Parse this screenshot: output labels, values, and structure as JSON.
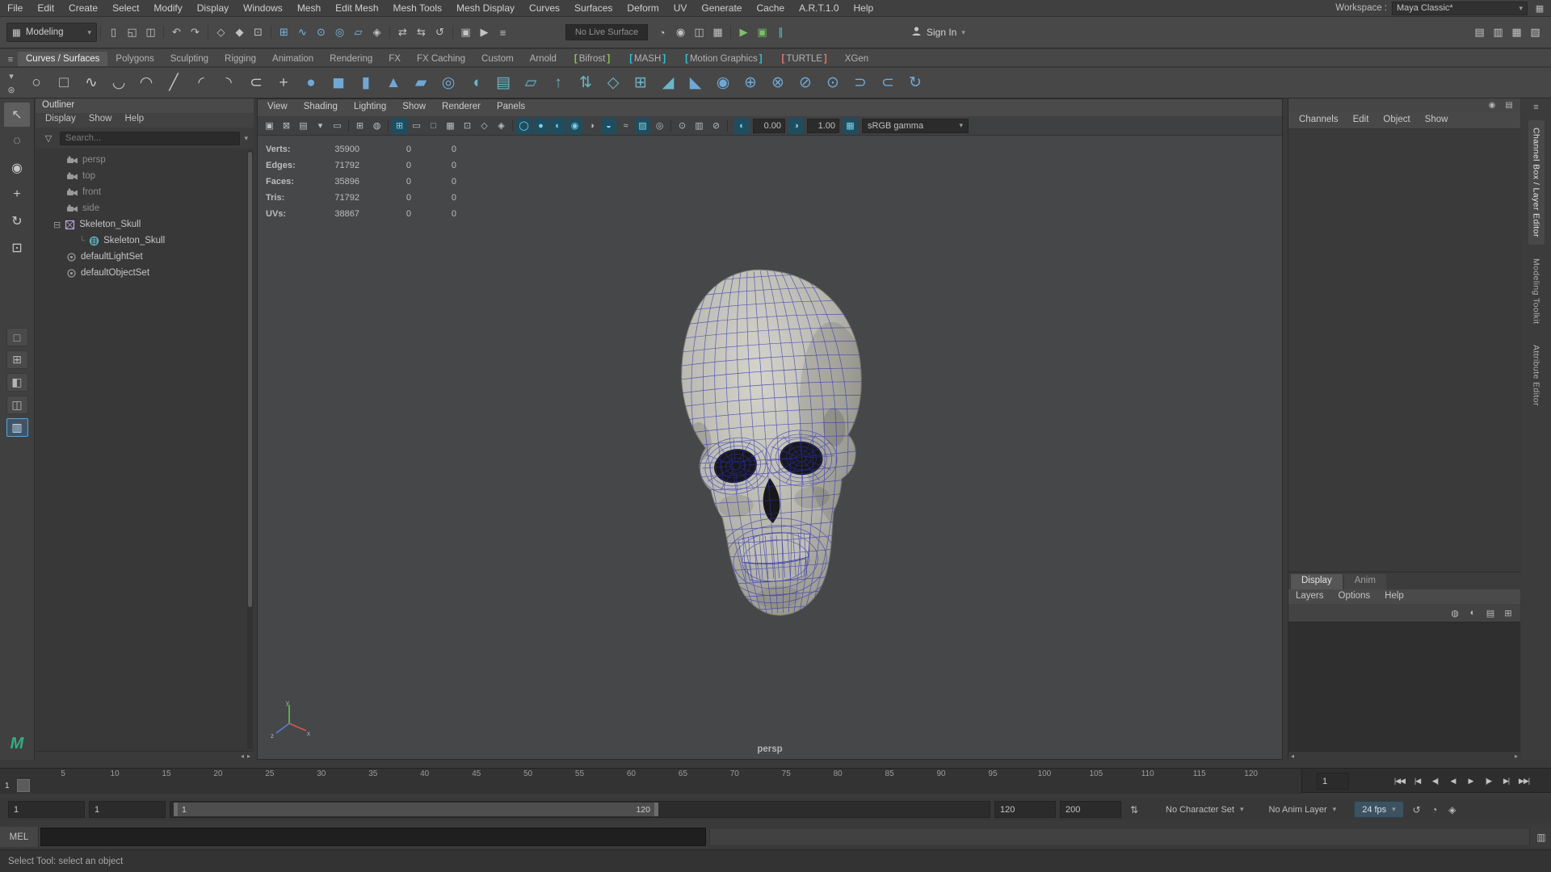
{
  "menubar": {
    "items": [
      "File",
      "Edit",
      "Create",
      "Select",
      "Modify",
      "Display",
      "Windows",
      "Mesh",
      "Edit Mesh",
      "Mesh Tools",
      "Mesh Display",
      "Curves",
      "Surfaces",
      "Deform",
      "UV",
      "Generate",
      "Cache",
      "A.R.T.1.0",
      "Help"
    ],
    "workspace_label": "Workspace :",
    "workspace_value": "Maya Classic*"
  },
  "statusline": {
    "mode": "Modeling",
    "live_surface": "No Live Surface",
    "sign_in": "Sign In",
    "icon_groups": [
      {
        "icons": [
          {
            "n": "new-scene",
            "g": "▯"
          },
          {
            "n": "open-scene",
            "g": "◱"
          },
          {
            "n": "save-scene",
            "g": "◫"
          }
        ]
      },
      {
        "icons": [
          {
            "n": "undo",
            "g": "↶"
          },
          {
            "n": "redo",
            "g": "↷"
          }
        ]
      },
      {
        "icons": [
          {
            "n": "select-by-hierarchy",
            "g": "◇"
          },
          {
            "n": "select-by-object-type",
            "g": "◆"
          },
          {
            "n": "select-by-component-type",
            "g": "⊡"
          }
        ]
      },
      {
        "icons": [
          {
            "n": "snap-to-grid",
            "g": "⊞",
            "c": "blue"
          },
          {
            "n": "snap-to-curve",
            "g": "∿",
            "c": "blue"
          },
          {
            "n": "snap-to-point",
            "g": "⊙",
            "c": "blue"
          },
          {
            "n": "snap-to-projected-center",
            "g": "◎",
            "c": "blue"
          },
          {
            "n": "snap-to-view-plane",
            "g": "▱",
            "c": "blue"
          },
          {
            "n": "make-object-live",
            "g": "◈"
          }
        ]
      },
      {
        "icons": [
          {
            "n": "input-connections",
            "g": "⇄"
          },
          {
            "n": "output-connections",
            "g": "⇆"
          },
          {
            "n": "construction-history",
            "g": "↺"
          }
        ]
      },
      {
        "icons": [
          {
            "n": "render-current-frame",
            "g": "▣"
          },
          {
            "n": "ipr-render",
            "g": "▶"
          },
          {
            "n": "render-settings",
            "g": "≡"
          }
        ]
      }
    ],
    "icon_groups2": [
      {
        "icons": [
          {
            "n": "fast-interaction",
            "g": "◔"
          },
          {
            "n": "camera-based-selection",
            "g": "◉"
          },
          {
            "n": "symmetry",
            "g": "◫"
          },
          {
            "n": "evaluation-toggle",
            "g": "▦"
          }
        ]
      },
      {
        "icons": [
          {
            "n": "viewport-renderer",
            "g": "▶",
            "c": "green"
          },
          {
            "n": "gpu-override",
            "g": "▣",
            "c": "green"
          },
          {
            "n": "pause-viewport",
            "g": "∥",
            "c": "teal"
          }
        ]
      }
    ],
    "right_icons": [
      {
        "n": "show-attribute-editor",
        "g": "▤"
      },
      {
        "n": "show-tool-settings",
        "g": "▥"
      },
      {
        "n": "show-channel-box",
        "g": "▦"
      },
      {
        "n": "show-workspace-panels",
        "g": "▧"
      }
    ]
  },
  "shelf": {
    "tabs": [
      {
        "label": "Curves / Surfaces",
        "active": true
      },
      {
        "label": "Polygons"
      },
      {
        "label": "Sculpting"
      },
      {
        "label": "Rigging"
      },
      {
        "label": "Animation"
      },
      {
        "label": "Rendering"
      },
      {
        "label": "FX"
      },
      {
        "label": "FX Caching"
      },
      {
        "label": "Custom"
      },
      {
        "label": "Arnold"
      },
      {
        "label": "Bifrost",
        "bracket": "#8bc34a"
      },
      {
        "label": "MASH",
        "bracket": "#26c6da"
      },
      {
        "label": "Motion Graphics",
        "bracket": "#26c6da"
      },
      {
        "label": "TURTLE",
        "bracket": "#e57373"
      },
      {
        "label": "XGen"
      }
    ],
    "icons": [
      {
        "n": "nurbs-circle",
        "g": "○"
      },
      {
        "n": "nurbs-square",
        "g": "□"
      },
      {
        "n": "cv-curve-tool",
        "g": "∿"
      },
      {
        "n": "ep-curve-tool",
        "g": "◡"
      },
      {
        "n": "bezier-curve-tool",
        "g": "◠"
      },
      {
        "n": "pencil-curve-tool",
        "g": "╱"
      },
      {
        "n": "arc-three-point",
        "g": "◜"
      },
      {
        "n": "arc-two-point",
        "g": "◝"
      },
      {
        "n": "offset-curve",
        "g": "⊂"
      },
      {
        "n": "insert-knot",
        "g": "+"
      },
      {
        "n": "nurbs-sphere",
        "g": "●",
        "c": "#6fa8d6"
      },
      {
        "n": "nurbs-cube",
        "g": "◼",
        "c": "#6fa8d6"
      },
      {
        "n": "nurbs-cylinder",
        "g": "▮",
        "c": "#6fa8d6"
      },
      {
        "n": "nurbs-cone",
        "g": "▲",
        "c": "#6fa8d6"
      },
      {
        "n": "nurbs-plane",
        "g": "▰",
        "c": "#6fa8d6"
      },
      {
        "n": "nurbs-torus",
        "g": "◎",
        "c": "#6fa8d6"
      },
      {
        "n": "revolve",
        "g": "◖",
        "c": "#69b6c9"
      },
      {
        "n": "loft",
        "g": "▤",
        "c": "#69b6c9"
      },
      {
        "n": "planar",
        "g": "▱",
        "c": "#69b6c9"
      },
      {
        "n": "extrude",
        "g": "↑",
        "c": "#69b6c9"
      },
      {
        "n": "birail",
        "g": "⇅",
        "c": "#69b6c9"
      },
      {
        "n": "boundary",
        "g": "◇",
        "c": "#69b6c9"
      },
      {
        "n": "square-surface",
        "g": "⊞",
        "c": "#69b6c9"
      },
      {
        "n": "bevel",
        "g": "◢",
        "c": "#69b6c9"
      },
      {
        "n": "bevel-plus",
        "g": "◣",
        "c": "#6fa8d6"
      },
      {
        "n": "sculpt-surface",
        "g": "◉",
        "c": "#6fa8d6"
      },
      {
        "n": "project-curve",
        "g": "⊕",
        "c": "#6fa8d6"
      },
      {
        "n": "intersect-surfaces",
        "g": "⊗",
        "c": "#6fa8d6"
      },
      {
        "n": "trim-tool",
        "g": "⊘",
        "c": "#6fa8d6"
      },
      {
        "n": "untrim",
        "g": "⊙",
        "c": "#6fa8d6"
      },
      {
        "n": "attach-surfaces",
        "g": "⊃",
        "c": "#6fa8d6"
      },
      {
        "n": "detach-surfaces",
        "g": "⊂",
        "c": "#6fa8d6"
      },
      {
        "n": "open-close-surface",
        "g": "↻",
        "c": "#6fa8d6"
      }
    ]
  },
  "toolbox": {
    "tools": [
      {
        "n": "select-tool",
        "g": "↖",
        "a": true
      },
      {
        "n": "lasso-tool",
        "g": "◌"
      },
      {
        "n": "paint-select-tool",
        "g": "◉"
      },
      {
        "n": "move-tool",
        "g": "+"
      },
      {
        "n": "rotate-tool",
        "g": "↻"
      },
      {
        "n": "scale-tool",
        "g": "⊡"
      }
    ],
    "layouts": [
      {
        "n": "single-pane-layout",
        "g": "□"
      },
      {
        "n": "four-pane-layout",
        "g": "⊞"
      },
      {
        "n": "persp-outliner-layout",
        "g": "◧"
      },
      {
        "n": "persp-graph-layout",
        "g": "◫"
      },
      {
        "n": "outliner-persp-layout",
        "g": "▥",
        "a": true
      }
    ]
  },
  "outliner": {
    "title": "Outliner",
    "menus": [
      "Display",
      "Show",
      "Help"
    ],
    "search_placeholder": "Search...",
    "items": [
      {
        "label": "persp",
        "icon": "camera",
        "pad": 38,
        "dim": true
      },
      {
        "label": "top",
        "icon": "camera",
        "pad": 38,
        "dim": true
      },
      {
        "label": "front",
        "icon": "camera",
        "pad": 38,
        "dim": true
      },
      {
        "label": "side",
        "icon": "camera",
        "pad": 38,
        "dim": true
      },
      {
        "label": "Skeleton_Skull",
        "icon": "transform",
        "pad": 22,
        "expander": true
      },
      {
        "label": "Skeleton_Skull",
        "icon": "shape",
        "pad": 54,
        "branch": true
      },
      {
        "label": "defaultLightSet",
        "icon": "set",
        "pad": 38
      },
      {
        "label": "defaultObjectSet",
        "icon": "set",
        "pad": 38
      }
    ]
  },
  "viewport": {
    "menus": [
      "View",
      "Shading",
      "Lighting",
      "Show",
      "Renderer",
      "Panels"
    ],
    "icons": [
      {
        "n": "select-camera",
        "g": "▣"
      },
      {
        "n": "lock-camera",
        "g": "⊠"
      },
      {
        "n": "camera-attributes",
        "g": "▤"
      },
      {
        "n": "bookmarks",
        "g": "▾"
      },
      {
        "n": "image-plane",
        "g": "▭"
      },
      {
        "d": true
      },
      {
        "n": "two-d-pan-zoom",
        "g": "⊞"
      },
      {
        "n": "oversampling",
        "g": "◍"
      },
      {
        "d": true
      },
      {
        "n": "grid-display",
        "g": "⊞",
        "a": true
      },
      {
        "n": "film-gate",
        "g": "▭"
      },
      {
        "n": "resolution-gate",
        "g": "□"
      },
      {
        "n": "gate-mask",
        "g": "▦"
      },
      {
        "n": "field-chart",
        "g": "⊡"
      },
      {
        "n": "safe-action",
        "g": "◇"
      },
      {
        "n": "safe-title",
        "g": "◈"
      },
      {
        "d": true
      },
      {
        "n": "wireframe-display",
        "g": "◯",
        "a": true
      },
      {
        "n": "shaded-display",
        "g": "●",
        "a": true
      },
      {
        "n": "textured-display",
        "g": "◐",
        "a": true
      },
      {
        "n": "use-all-lights",
        "g": "◉",
        "a": true
      },
      {
        "n": "shadows",
        "g": "◑"
      },
      {
        "n": "screen-space-ao",
        "g": "◒",
        "a": true
      },
      {
        "n": "motion-blur",
        "g": "≈"
      },
      {
        "n": "multisample-aa",
        "g": "▨",
        "a": true
      },
      {
        "n": "depth-of-field",
        "g": "◎"
      },
      {
        "d": true
      },
      {
        "n": "isolate-select",
        "g": "⊙"
      },
      {
        "n": "x-ray",
        "g": "▥"
      },
      {
        "n": "x-ray-joints",
        "g": "⊘"
      },
      {
        "d": true
      }
    ],
    "exposure": "0.00",
    "gamma": "1.00",
    "colorspace": "sRGB gamma",
    "hud_rows": [
      {
        "label": "Verts:",
        "value": "35900",
        "sel": "0",
        "other": "0"
      },
      {
        "label": "Edges:",
        "value": "71792",
        "sel": "0",
        "other": "0"
      },
      {
        "label": "Faces:",
        "value": "35896",
        "sel": "0",
        "other": "0"
      },
      {
        "label": "Tris:",
        "value": "71792",
        "sel": "0",
        "other": "0"
      },
      {
        "label": "UVs:",
        "value": "38867",
        "sel": "0",
        "other": "0"
      }
    ],
    "camera_label": "persp"
  },
  "channel_box": {
    "menus": [
      "Channels",
      "Edit",
      "Object",
      "Show"
    ],
    "header_icons": [
      {
        "n": "channel-display-toggle",
        "g": "◉",
        "c": "red"
      },
      {
        "n": "channel-layout",
        "g": "▤"
      }
    ]
  },
  "layer_editor": {
    "tabs": [
      {
        "label": "Display",
        "active": true
      },
      {
        "label": "Anim",
        "active": false
      }
    ],
    "menus": [
      "Layers",
      "Options",
      "Help"
    ],
    "icons": [
      {
        "n": "toggle-layer-visibility",
        "g": "◍"
      },
      {
        "n": "layer-playback-toggle",
        "g": "◐"
      },
      {
        "n": "layer-render-toggle",
        "g": "▤"
      },
      {
        "n": "create-new-layer",
        "g": "⊞"
      }
    ]
  },
  "side_tabs": [
    {
      "label": "Channel Box / Layer Editor",
      "active": true
    },
    {
      "label": "Modeling Toolkit",
      "active": false
    },
    {
      "label": "Attribute Editor",
      "active": false
    }
  ],
  "timeline": {
    "ticks": [
      "5",
      "10",
      "15",
      "20",
      "25",
      "30",
      "35",
      "40",
      "45",
      "50",
      "55",
      "60",
      "65",
      "70",
      "75",
      "80",
      "85",
      "90",
      "95",
      "100",
      "105",
      "110",
      "115",
      "120"
    ],
    "current_frame": "1",
    "current_time": "1",
    "playback": [
      {
        "n": "go-to-playback-start",
        "g": "|◀◀"
      },
      {
        "n": "step-back-one-frame",
        "g": "|◀"
      },
      {
        "n": "step-back-one-key",
        "g": "◀|"
      },
      {
        "n": "play-backwards",
        "g": "◀"
      },
      {
        "n": "play-forwards",
        "g": "▶"
      },
      {
        "n": "step-forward-one-key",
        "g": "|▶"
      },
      {
        "n": "step-forward-one-frame",
        "g": "▶|"
      },
      {
        "n": "go-to-playback-end",
        "g": "▶▶|"
      }
    ]
  },
  "range": {
    "animation_start": "1",
    "playback_start": "1",
    "range_bar_start": "1",
    "range_bar_end": "120",
    "playback_end": "120",
    "animation_end": "200",
    "character_set": "No Character Set",
    "anim_layer": "No Anim Layer",
    "fps": "24 fps",
    "icons": [
      {
        "n": "playback-loop",
        "g": "↺"
      },
      {
        "n": "playback-speed",
        "g": "◔"
      },
      {
        "n": "auto-keyframe",
        "g": "◈"
      }
    ]
  },
  "command_line": {
    "label": "MEL"
  },
  "help_line": {
    "text": "Select Tool: select an object"
  },
  "colors": {
    "accent": "#57a7d3",
    "wireframe_blue": "#2e2eb0",
    "bone": "#b8b8b0",
    "viewport_bg": "#454749"
  }
}
